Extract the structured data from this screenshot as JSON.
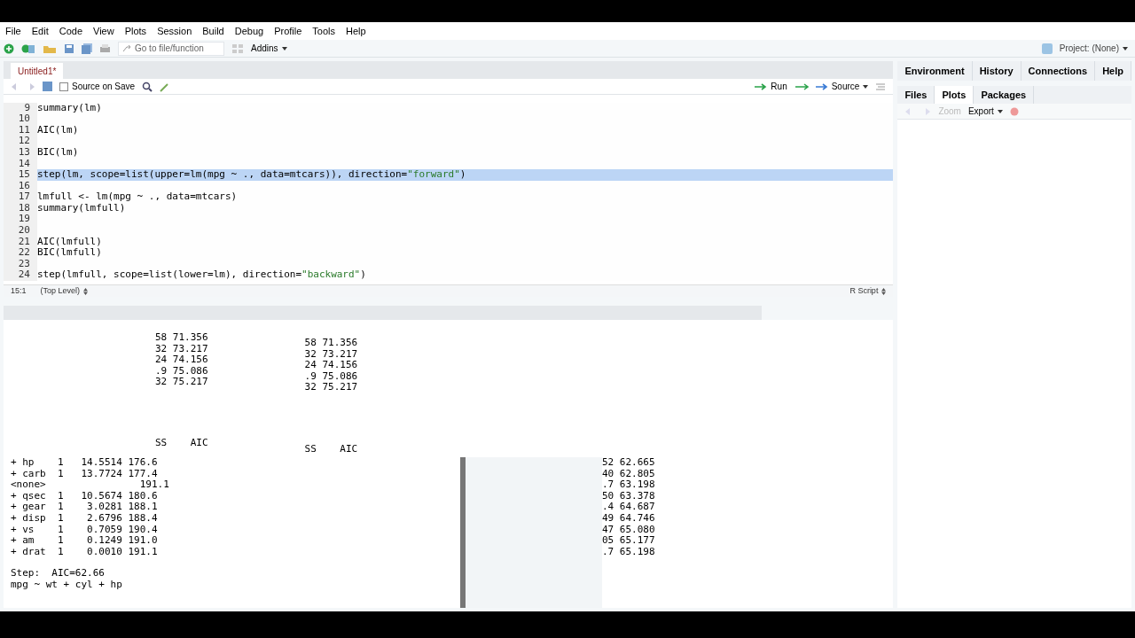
{
  "menu": [
    "File",
    "Edit",
    "Code",
    "View",
    "Plots",
    "Session",
    "Build",
    "Debug",
    "Profile",
    "Tools",
    "Help"
  ],
  "toolbar": {
    "goto_placeholder": "Go to file/function",
    "addins": "Addins",
    "project": "Project: (None)"
  },
  "editor": {
    "tabs": [
      {
        "label": "Untitled1*",
        "selected": true
      }
    ],
    "source_on_save": {
      "label": "Source on Save",
      "checked": false
    },
    "run": "Run",
    "source": "Source",
    "lines": [
      {
        "number": "9",
        "text": "summary(lm)",
        "selected": false
      },
      {
        "number": "10",
        "selected": false
      },
      {
        "number": "11",
        "text": "AIC(lm)",
        "selected": false
      },
      {
        "number": "12",
        "selected": false
      },
      {
        "number": "13",
        "text": "BIC(lm)",
        "selected": false
      },
      {
        "number": "14",
        "selected": false
      },
      {
        "number": "15",
        "text": "step(lm, scope=list(upper=lm(mpg ~ ., data=mtcars)), direction=\"forward\")",
        "selected": true
      },
      {
        "number": "16",
        "selected": false
      },
      {
        "number": "17",
        "text": "lmfull <- lm(mpg ~ ., data=mtcars)",
        "selected": false
      },
      {
        "number": "18",
        "text": "summary(lmfull)",
        "selected": false
      },
      {
        "number": "19",
        "selected": false
      },
      {
        "number": "20",
        "selected": false
      },
      {
        "number": "21",
        "text": "AIC(lmfull)",
        "selected": false
      },
      {
        "number": "22",
        "text": "BIC(lmfull)",
        "selected": false
      },
      {
        "number": "23",
        "selected": false
      },
      {
        "number": "24",
        "text": "step(lmfull, scope=list(lower=lm), direction=\"backward\")",
        "selected": false
      }
    ],
    "status": {
      "position": "15:1",
      "scope": "(Top Level)",
      "type": "R Script"
    }
  },
  "right_pane": {
    "top_tabs": [
      {
        "label": "Environment",
        "selected": false
      },
      {
        "label": "History",
        "selected": false
      },
      {
        "label": "Connections",
        "selected": false
      },
      {
        "label": "Help",
        "selected": false
      }
    ],
    "bottom_tabs": [
      {
        "label": "Files",
        "selected": false
      },
      {
        "label": "Plots",
        "selected": true
      },
      {
        "label": "Packages",
        "selected": false
      }
    ],
    "zoom": "Zoom",
    "export": "Export"
  },
  "console": {
    "upper_left": [
      "58 71.356",
      "32 73.217",
      "24 74.156",
      ".9 75.086",
      "32 75.217"
    ],
    "upper_right": [
      "58 71.356",
      "32 73.217",
      "24 74.156",
      ".9 75.086",
      "32 75.217"
    ],
    "header_left": "SS    AIC",
    "header_right": "SS    AIC",
    "table_rows": [
      "+ hp    1   14.5514 176.6",
      "+ carb  1   13.7724 177.4",
      "<none>                191.1",
      "+ qsec  1   10.5674 180.6",
      "+ gear  1    3.0281 188.1",
      "+ disp  1    2.6796 188.4",
      "+ vs    1    0.7059 190.4",
      "+ am    1    0.1249 191.0",
      "+ drat  1    0.0010 191.1"
    ],
    "right_values": [
      "52 62.665",
      "40 62.805",
      ".7 63.198",
      "50 63.378",
      ".4 64.687",
      "49 64.746",
      "47 65.080",
      "05 65.177",
      ".7 65.198"
    ],
    "step_lines": [
      "Step:  AIC=62.66",
      "mpg ~ wt + cyl + hp"
    ]
  }
}
